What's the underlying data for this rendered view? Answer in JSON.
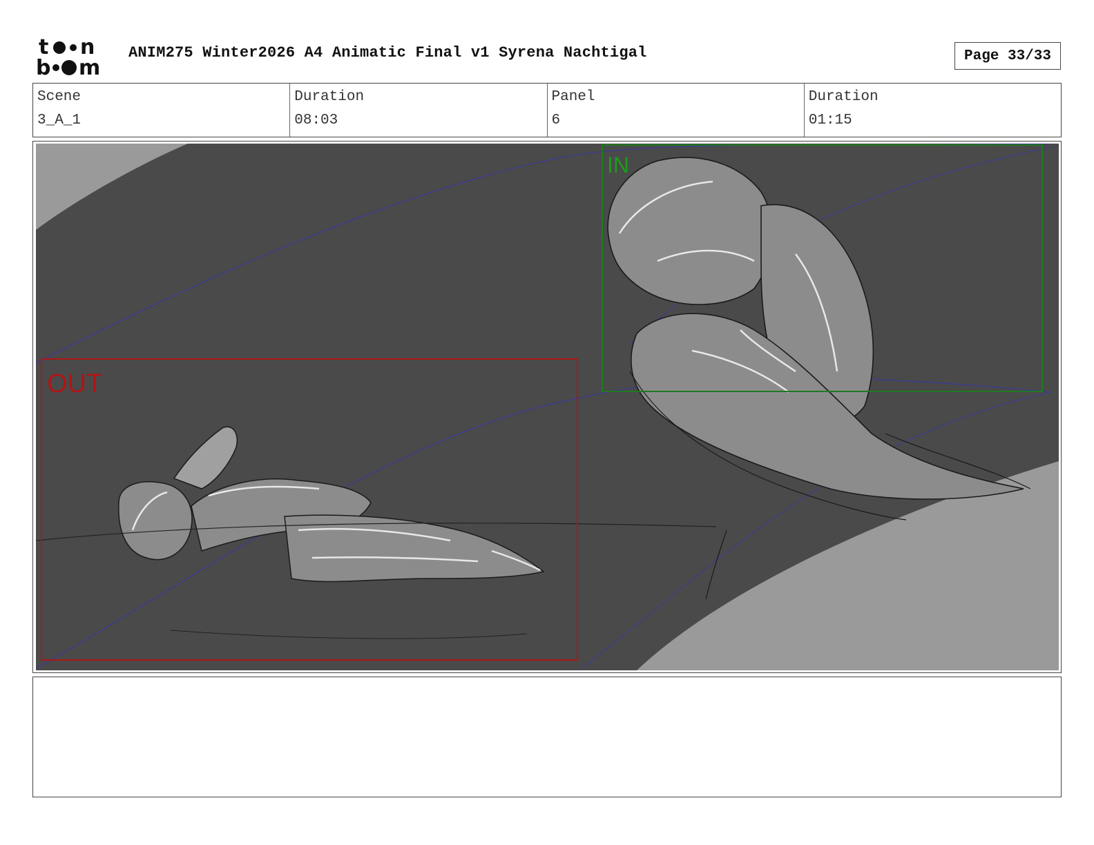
{
  "header": {
    "logo_text": "toonboom",
    "title": "ANIM275 Winter2026 A4 Animatic Final v1 Syrena Nachtigal",
    "page_label": "Page 33/33"
  },
  "info": {
    "scene_label": "Scene",
    "scene_value": "3_A_1",
    "scene_duration_label": "Duration",
    "scene_duration_value": "08:03",
    "panel_label": "Panel",
    "panel_value": "6",
    "panel_duration_label": "Duration",
    "panel_duration_value": "01:15"
  },
  "panel": {
    "out_frame_label": "OUT",
    "in_frame_label": "IN",
    "colors": {
      "background_dark": "#4a4a4a",
      "background_light": "#9a9a9a",
      "out_frame": "#b01515",
      "in_frame": "#1f7a1f",
      "camera_path": "#3a3a9a"
    }
  },
  "notes": {
    "text": ""
  }
}
